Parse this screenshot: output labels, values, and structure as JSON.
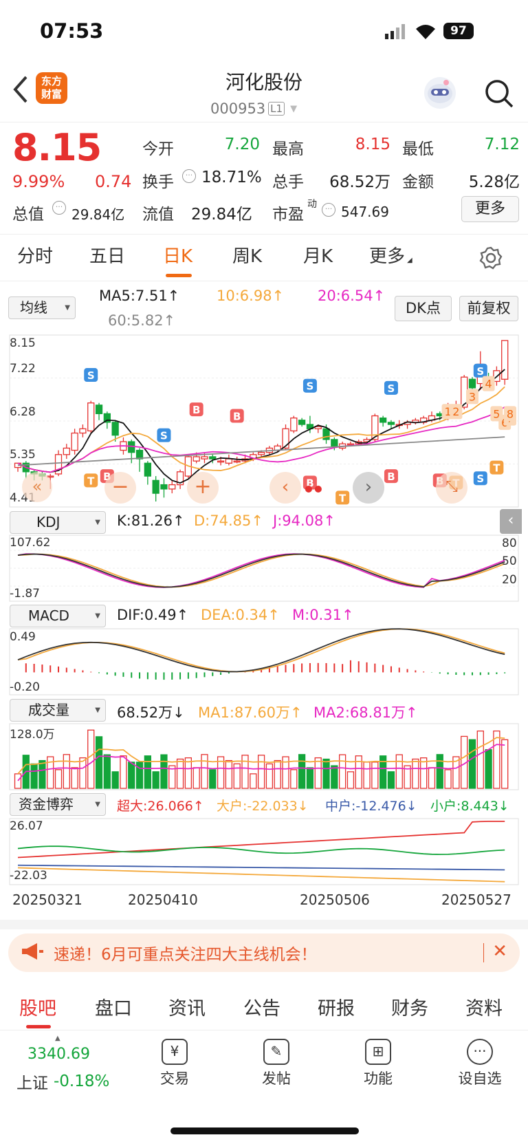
{
  "status": {
    "time": "07:53",
    "battery": "97"
  },
  "header": {
    "logo_line1": "东方",
    "logo_line2": "财富",
    "title": "河化股份",
    "code": "000953",
    "level": "L1"
  },
  "quote": {
    "price": "8.15",
    "pct": "9.99%",
    "change": "0.74",
    "open_label": "今开",
    "open": "7.20",
    "high_label": "最高",
    "high": "8.15",
    "low_label": "最低",
    "low": "7.12",
    "turnover_label": "换手",
    "turnover": "18.71%",
    "vol_label": "总手",
    "vol": "68.52万",
    "amount_label": "金额",
    "amount": "5.28亿",
    "mcap_label": "总值",
    "mcap": "29.84亿",
    "float_label": "流值",
    "float": "29.84亿",
    "pe_label": "市盈",
    "pe_sup": "动",
    "pe": "547.69",
    "more": "更多"
  },
  "tabs": [
    "分时",
    "五日",
    "日K",
    "周K",
    "月K",
    "更多"
  ],
  "active_tab": "日K",
  "ma": {
    "selector": "均线",
    "ma5": "MA5:7.51↑",
    "ma10": "10:6.98↑",
    "ma20": "20:6.54↑",
    "ma60": "60:5.82↑",
    "dk": "DK点",
    "adj": "前复权"
  },
  "main_axis": [
    "8.15",
    "7.22",
    "6.28",
    "5.35",
    "4.41"
  ],
  "kdj": {
    "selector": "KDJ",
    "k": "K:81.26↑",
    "d": "D:74.85↑",
    "j": "J:94.08↑",
    "top": "107.62",
    "bottom": "-1.87",
    "levels": [
      "80",
      "50",
      "20"
    ]
  },
  "macd": {
    "selector": "MACD",
    "dif": "DIF:0.49↑",
    "dea": "DEA:0.34↑",
    "m": "M:0.31↑",
    "top": "0.49",
    "bottom": "-0.20"
  },
  "volume": {
    "selector": "成交量",
    "vol": "68.52万↓",
    "ma1": "MA1:87.60万↑",
    "ma2": "MA2:68.81万↑",
    "top": "128.0万"
  },
  "funds": {
    "selector": "资金博弈",
    "super": "超大:26.066↑",
    "large": "大户:-22.033↓",
    "mid": "中户:-12.476↓",
    "small": "小户:8.443↓",
    "top": "26.07",
    "bottom": "-22.03"
  },
  "dates": [
    "20250321",
    "20250410",
    "20250506",
    "20250527"
  ],
  "banner": {
    "text": "速递！6月可重点关注四大主线机会！"
  },
  "bottom_tabs": [
    "股吧",
    "盘口",
    "资讯",
    "公告",
    "研报",
    "财务",
    "资料"
  ],
  "index": {
    "value": "3340.69",
    "name": "上证",
    "pct": "-0.18%"
  },
  "toolbar": [
    "交易",
    "发帖",
    "功能",
    "设自选"
  ],
  "colors": {
    "up": "#e5312f",
    "down": "#13a53a",
    "accent": "#f06a14"
  },
  "chart_data": {
    "type": "candlestick",
    "ylim": [
      4.41,
      8.15
    ],
    "candles": [
      [
        5.2,
        5.3,
        5.1,
        5.3
      ],
      [
        5.3,
        5.1,
        4.95,
        5.35
      ],
      [
        5.1,
        5.05,
        4.9,
        5.15
      ],
      [
        5.05,
        5.0,
        4.9,
        5.1
      ],
      [
        5.0,
        5.0,
        4.7,
        5.05
      ],
      [
        5.05,
        5.5,
        5.0,
        5.6
      ],
      [
        5.5,
        5.65,
        5.4,
        5.75
      ],
      [
        5.6,
        6.0,
        5.5,
        6.1
      ],
      [
        6.0,
        6.1,
        5.9,
        6.2
      ],
      [
        6.05,
        6.7,
        6.0,
        6.75
      ],
      [
        6.65,
        6.45,
        6.3,
        6.7
      ],
      [
        6.45,
        6.25,
        6.1,
        6.5
      ],
      [
        6.25,
        5.95,
        5.8,
        6.3
      ],
      [
        5.6,
        5.8,
        5.5,
        5.9
      ],
      [
        5.8,
        5.55,
        5.3,
        5.85
      ],
      [
        5.6,
        5.4,
        5.1,
        5.65
      ],
      [
        5.3,
        5.0,
        4.8,
        5.35
      ],
      [
        4.9,
        4.6,
        4.41,
        5.0
      ],
      [
        4.8,
        4.7,
        4.5,
        4.95
      ],
      [
        4.7,
        4.8,
        4.6,
        4.9
      ],
      [
        4.8,
        5.1,
        4.7,
        5.15
      ],
      [
        5.0,
        5.45,
        4.95,
        5.5
      ],
      [
        5.35,
        5.45,
        5.3,
        5.55
      ],
      [
        5.4,
        5.45,
        5.3,
        5.55
      ],
      [
        5.45,
        5.4,
        5.3,
        5.5
      ],
      [
        5.35,
        5.35,
        5.25,
        5.45
      ],
      [
        5.3,
        5.4,
        5.25,
        5.5
      ],
      [
        5.35,
        5.35,
        5.3,
        5.45
      ],
      [
        5.35,
        5.4,
        5.3,
        5.5
      ],
      [
        5.4,
        5.5,
        5.35,
        5.55
      ],
      [
        5.5,
        5.55,
        5.45,
        5.6
      ],
      [
        5.55,
        5.65,
        5.5,
        5.7
      ],
      [
        5.6,
        5.7,
        5.55,
        5.75
      ],
      [
        5.65,
        6.1,
        5.6,
        6.2
      ],
      [
        6.05,
        6.35,
        6.0,
        6.4
      ],
      [
        6.3,
        6.2,
        6.15,
        6.35
      ],
      [
        6.2,
        6.1,
        6.0,
        6.4
      ],
      [
        6.1,
        6.15,
        6.0,
        6.2
      ],
      [
        6.1,
        5.85,
        5.75,
        6.2
      ],
      [
        5.85,
        5.7,
        5.6,
        5.9
      ],
      [
        5.65,
        5.75,
        5.6,
        5.8
      ],
      [
        5.75,
        5.75,
        5.7,
        5.8
      ],
      [
        5.75,
        5.8,
        5.7,
        5.85
      ],
      [
        5.8,
        5.85,
        5.75,
        5.9
      ],
      [
        5.85,
        6.4,
        5.8,
        6.45
      ],
      [
        6.35,
        6.25,
        6.15,
        6.4
      ],
      [
        6.25,
        6.2,
        6.1,
        6.3
      ],
      [
        6.2,
        6.2,
        6.1,
        6.3
      ],
      [
        6.2,
        6.25,
        6.1,
        6.3
      ],
      [
        6.25,
        6.3,
        6.2,
        6.35
      ],
      [
        6.25,
        6.35,
        6.2,
        6.4
      ],
      [
        6.3,
        6.4,
        6.25,
        6.5
      ],
      [
        6.45,
        6.4,
        6.3,
        6.5
      ],
      [
        6.35,
        6.6,
        6.3,
        6.7
      ],
      [
        6.55,
        6.65,
        6.5,
        6.75
      ],
      [
        6.6,
        7.3,
        6.55,
        7.35
      ],
      [
        7.25,
        7.05,
        6.9,
        7.3
      ],
      [
        7.15,
        7.6,
        7.0,
        7.9
      ],
      [
        7.3,
        7.15,
        7.0,
        7.4
      ],
      [
        7.2,
        7.45,
        7.1,
        7.55
      ],
      [
        7.25,
        8.15,
        7.12,
        8.15
      ]
    ]
  }
}
